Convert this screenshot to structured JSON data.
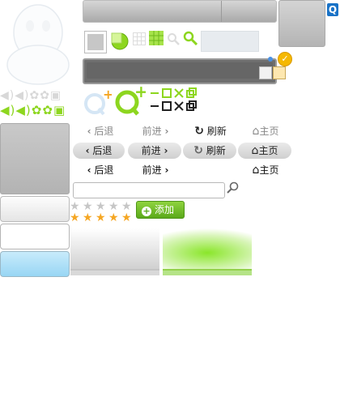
{
  "nav": {
    "back": "后退",
    "forward": "前进",
    "refresh": "刷新",
    "home": "主页"
  },
  "search": {
    "placeholder": ""
  },
  "add_button": {
    "label": "添加"
  },
  "rating": {
    "gray_stars": 5,
    "orange_stars": 5
  },
  "colors": {
    "accent_green": "#8dd61f",
    "qq_blue": "#1a73c7",
    "star_orange": "#f5a623"
  },
  "icons": [
    "qq-penguin-icon",
    "minimize-icon",
    "maximize-icon",
    "close-icon",
    "search-icon",
    "grid-icon",
    "refresh-icon",
    "home-icon",
    "star-icon",
    "plus-icon",
    "check-icon",
    "gear-icon",
    "volume-icon"
  ]
}
